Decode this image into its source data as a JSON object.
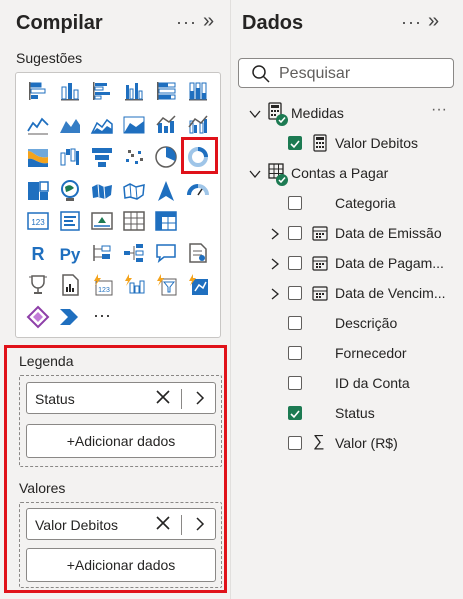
{
  "build_pane": {
    "title": "Compilar",
    "more": "···",
    "collapse": "»",
    "suggestions_label": "Sugestões",
    "more_visuals": "···",
    "visuals": [
      "stacked-bar-icon",
      "stacked-column-icon",
      "clustered-bar-icon",
      "clustered-column-icon",
      "100-stacked-bar-icon",
      "100-stacked-column-icon",
      "line-chart-icon",
      "area-chart-icon",
      "stacked-area-icon",
      "100-stacked-area-icon",
      "line-stacked-column-icon",
      "line-clustered-column-icon",
      "ribbon-chart-icon",
      "waterfall-icon",
      "funnel-icon",
      "scatter-icon",
      "pie-chart-icon",
      "donut-chart-icon",
      "treemap-icon",
      "map-icon",
      "filled-map-icon",
      "shape-map-icon",
      "azure-map-icon",
      "gauge-icon",
      "card-icon",
      "multi-row-card-icon",
      "kpi-icon",
      "table-icon",
      "matrix-icon",
      "r-visual-icon",
      "python-visual-icon",
      "key-influencers-icon",
      "decomposition-tree-icon",
      "qa-icon",
      "smart-narrative-icon",
      "goals-icon",
      "paginated-report-icon",
      "power-apps-icon",
      "power-automate-icon",
      "filter-icon",
      "arcgis-icon",
      "power-apps-app-icon",
      "power-automate-flow-icon"
    ],
    "legend_label": "Legenda",
    "legend_field": "Status",
    "values_label": "Valores",
    "values_field": "Valor Debitos",
    "add_data": "+Adicionar dados"
  },
  "data_pane": {
    "title": "Dados",
    "more": "···",
    "collapse": "»",
    "search_placeholder": "Pesquisar",
    "tables": [
      {
        "name": "Medidas",
        "more": "···",
        "fields": [
          {
            "name": "Valor Debitos",
            "checked": true,
            "icon": "calculator-icon"
          }
        ]
      },
      {
        "name": "Contas a Pagar",
        "fields": [
          {
            "name": "Categoria",
            "checked": false
          },
          {
            "name": "Data de Emissão",
            "checked": false,
            "icon": "calendar-icon"
          },
          {
            "name": "Data de Pagam...",
            "checked": false,
            "icon": "calendar-icon"
          },
          {
            "name": "Data de Vencim...",
            "checked": false,
            "icon": "calendar-icon"
          },
          {
            "name": "Descrição",
            "checked": false
          },
          {
            "name": "Fornecedor",
            "checked": false
          },
          {
            "name": "ID da Conta",
            "checked": false
          },
          {
            "name": "Status",
            "checked": true
          },
          {
            "name": "Valor (R$)",
            "checked": false,
            "icon": "sigma-icon",
            "icon_glyph": "∑"
          }
        ]
      }
    ]
  },
  "colors": {
    "accent": "#1c7a52",
    "highlight": "#e0121a",
    "icon_blue": "#1f6fbf",
    "icon_orange": "#f4a31c"
  }
}
